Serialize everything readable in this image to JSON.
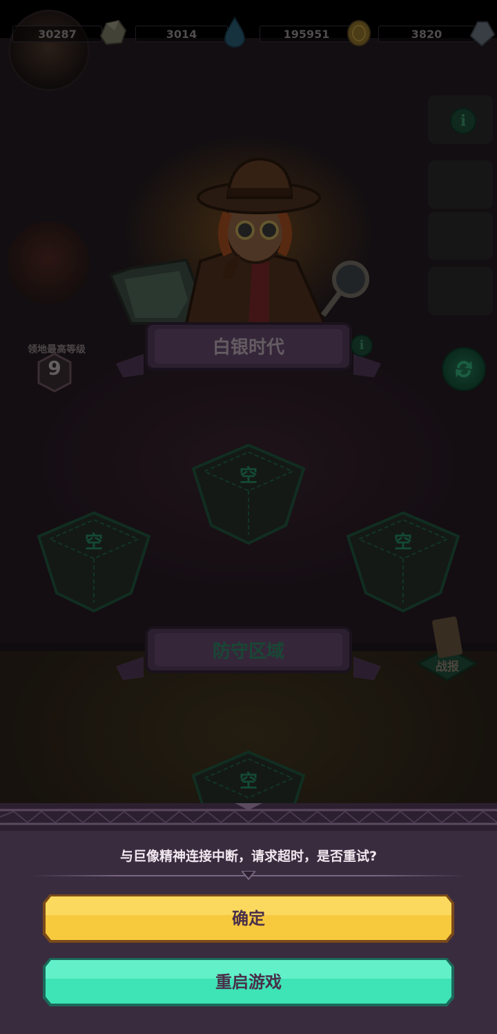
{
  "resources": [
    {
      "value": "30287",
      "icon": "stone-icon"
    },
    {
      "value": "3014",
      "icon": "water-drop-icon"
    },
    {
      "value": "195951",
      "icon": "gold-coin-icon"
    },
    {
      "value": "3820",
      "icon": "crystal-icon"
    }
  ],
  "side_menu": {
    "items": [
      "",
      "",
      "",
      ""
    ]
  },
  "left_hero": {
    "label": ""
  },
  "era_banner": {
    "title": "白银时代",
    "info_icon": "info-icon"
  },
  "territory": {
    "label": "领地最高等级",
    "level": "9"
  },
  "slots": {
    "empty_label": "空"
  },
  "defense_banner": {
    "title": "防守区域"
  },
  "battle_report": {
    "label": "战报"
  },
  "dialog": {
    "message": "与巨像精神连接中断，请求超时，是否重试?",
    "confirm_label": "确定",
    "restart_label": "重启游戏"
  },
  "colors": {
    "confirm_button": "#f7c93d",
    "restart_button": "#3ee3b6",
    "dialog_background": "#3a2c3f",
    "button_text": "#4a2f4a"
  }
}
